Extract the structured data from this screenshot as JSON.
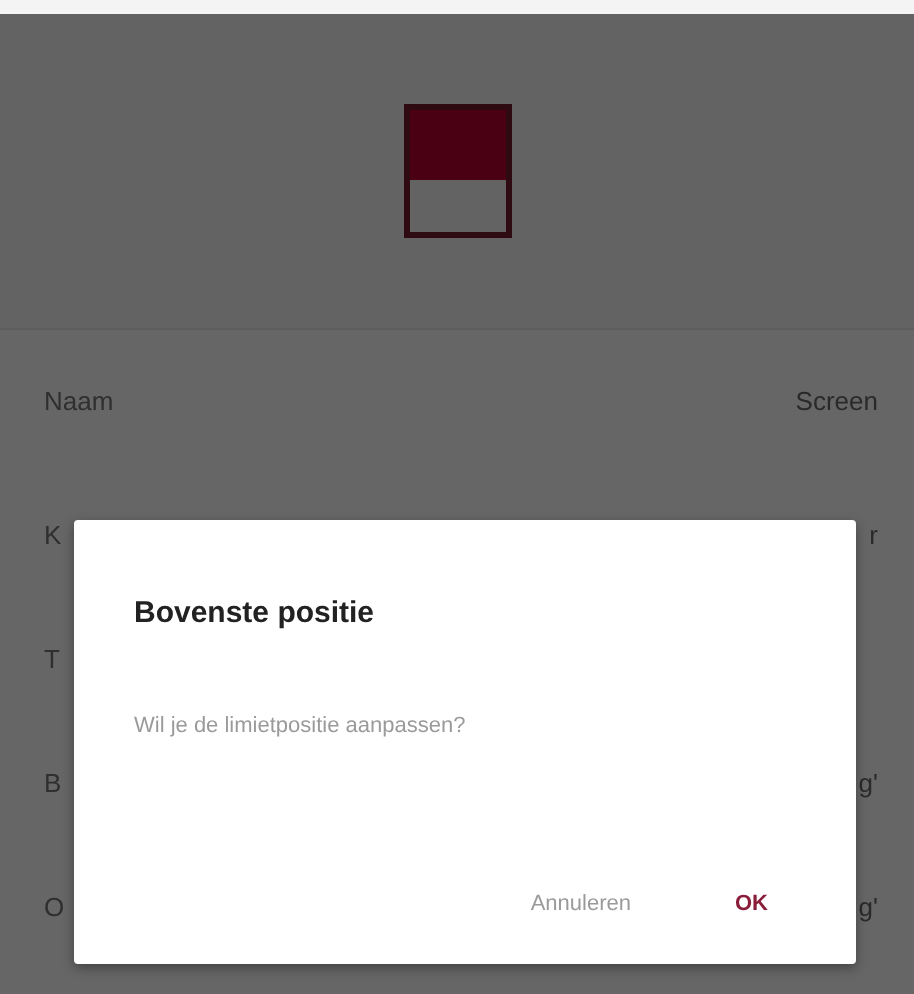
{
  "rows": [
    {
      "label": "Naam",
      "value": "Screen"
    },
    {
      "label": "K",
      "value": "r"
    },
    {
      "label": "T"
    },
    {
      "label": "B",
      "value": "g'"
    },
    {
      "label": "O",
      "value": "g'"
    }
  ],
  "dialog": {
    "title": "Bovenste positie",
    "message": "Wil je de limietpositie aanpassen?",
    "buttons": [
      {
        "label": "Annuleren",
        "kind": "secondary"
      },
      {
        "label": "OK",
        "kind": "primary"
      }
    ]
  }
}
